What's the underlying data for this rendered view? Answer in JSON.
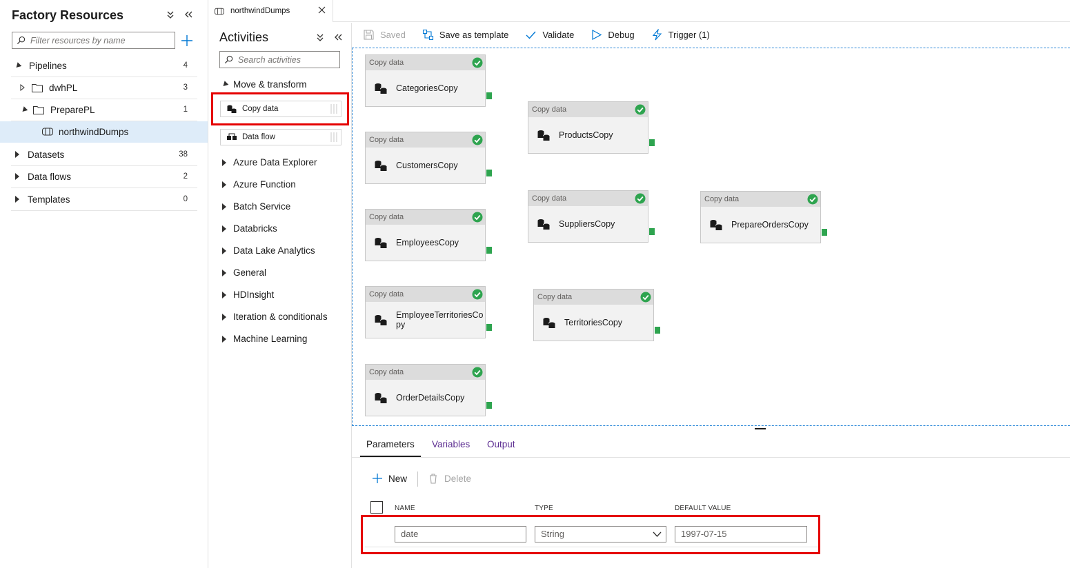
{
  "resources": {
    "title": "Factory Resources",
    "search_placeholder": "Filter resources by name",
    "pipelines": {
      "label": "Pipelines",
      "count": "4"
    },
    "dwhpl": {
      "label": "dwhPL",
      "count": "3"
    },
    "preparepl": {
      "label": "PreparePL",
      "count": "1"
    },
    "northwind": {
      "label": "northwindDumps"
    },
    "datasets": {
      "label": "Datasets",
      "count": "38"
    },
    "dataflows": {
      "label": "Data flows",
      "count": "2"
    },
    "templates": {
      "label": "Templates",
      "count": "0"
    }
  },
  "tab": {
    "label": "northwindDumps"
  },
  "activities": {
    "title": "Activities",
    "search_placeholder": "Search activities",
    "move_transform": "Move & transform",
    "copy_data": "Copy data",
    "data_flow": "Data flow",
    "categories": [
      "Azure Data Explorer",
      "Azure Function",
      "Batch Service",
      "Databricks",
      "Data Lake Analytics",
      "General",
      "HDInsight",
      "Iteration & conditionals",
      "Machine Learning"
    ]
  },
  "toolbar": {
    "saved": "Saved",
    "save_template": "Save as template",
    "validate": "Validate",
    "debug": "Debug",
    "trigger": "Trigger (1)"
  },
  "nodes": [
    {
      "type": "Copy data",
      "name": "CategoriesCopy"
    },
    {
      "type": "Copy data",
      "name": "CustomersCopy"
    },
    {
      "type": "Copy data",
      "name": "EmployeesCopy"
    },
    {
      "type": "Copy data",
      "name": "EmployeeTerritoriesCopy"
    },
    {
      "type": "Copy data",
      "name": "OrderDetailsCopy"
    },
    {
      "type": "Copy data",
      "name": "ProductsCopy"
    },
    {
      "type": "Copy data",
      "name": "SuppliersCopy"
    },
    {
      "type": "Copy data",
      "name": "TerritoriesCopy"
    },
    {
      "type": "Copy data",
      "name": "PrepareOrdersCopy"
    }
  ],
  "bottom": {
    "tabs": {
      "parameters": "Parameters",
      "variables": "Variables",
      "output": "Output"
    },
    "new": "New",
    "delete": "Delete",
    "columns": {
      "name": "NAME",
      "type": "TYPE",
      "default": "DEFAULT VALUE"
    },
    "param": {
      "name": "date",
      "type": "String",
      "default": "1997-07-15"
    }
  },
  "colors": {
    "accent": "#0078d4",
    "selected": "#deecf9",
    "highlight": "#e50000",
    "success": "#2ea44f",
    "link": "#5c2d91"
  }
}
